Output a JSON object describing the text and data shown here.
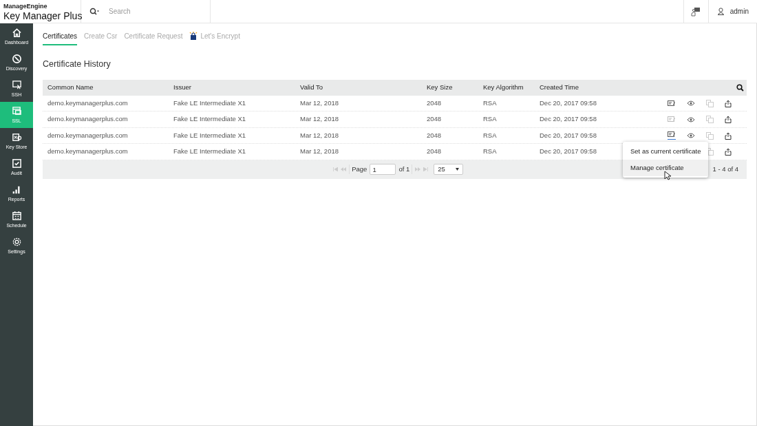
{
  "header": {
    "brand_top": "ManageEngine",
    "brand": "Key Manager Plus",
    "search": {
      "placeholder": "Search"
    },
    "user": "admin"
  },
  "sidebar": {
    "items": [
      {
        "label": "Dashboard",
        "selected": false
      },
      {
        "label": "Discovery",
        "selected": false
      },
      {
        "label": "SSH",
        "selected": false
      },
      {
        "label": "SSL",
        "selected": true
      },
      {
        "label": "Key Store",
        "selected": false
      },
      {
        "label": "Audit",
        "selected": false
      },
      {
        "label": "Reports",
        "selected": false
      },
      {
        "label": "Schedule",
        "selected": false
      },
      {
        "label": "Settings",
        "selected": false
      }
    ]
  },
  "tabs": [
    {
      "label": "Certificates",
      "selected": true,
      "badge": false
    },
    {
      "label": "Create Csr",
      "selected": false,
      "badge": false
    },
    {
      "label": "Certificate Request",
      "selected": false,
      "badge": false
    },
    {
      "label": "Let's Encrypt",
      "selected": false,
      "badge": true
    }
  ],
  "section_title": "Certificate History",
  "table": {
    "columns": [
      "Common Name",
      "Issuer",
      "Valid To",
      "Key Size",
      "Key Algorithm",
      "Created Time"
    ],
    "rows": [
      {
        "cells": [
          "demo.keymanagerplus.com",
          "Fake LE Intermediate X1",
          "Mar 12, 2018",
          "2048",
          "RSA",
          "Dec 20, 2017 09:58"
        ],
        "manage_enabled": true,
        "menu_open": false
      },
      {
        "cells": [
          "demo.keymanagerplus.com",
          "Fake LE Intermediate X1",
          "Mar 12, 2018",
          "2048",
          "RSA",
          "Dec 20, 2017 09:58"
        ],
        "manage_enabled": false,
        "menu_open": false
      },
      {
        "cells": [
          "demo.keymanagerplus.com",
          "Fake LE Intermediate X1",
          "Mar 12, 2018",
          "2048",
          "RSA",
          "Dec 20, 2017 09:58"
        ],
        "manage_enabled": true,
        "menu_open": true
      },
      {
        "cells": [
          "demo.keymanagerplus.com",
          "Fake LE Intermediate X1",
          "Mar 12, 2018",
          "2048",
          "RSA",
          "Dec 20, 2017 09:58"
        ],
        "menu_open": false
      }
    ]
  },
  "pagination": {
    "page_label": "Page",
    "page": "1",
    "of": "of 1",
    "per_page": "25",
    "summary": "1 - 4 of 4"
  },
  "context_menu": {
    "items": [
      {
        "label": "Set as current certificate",
        "selected": false
      },
      {
        "label": "Manage certificate",
        "selected": true
      }
    ]
  }
}
